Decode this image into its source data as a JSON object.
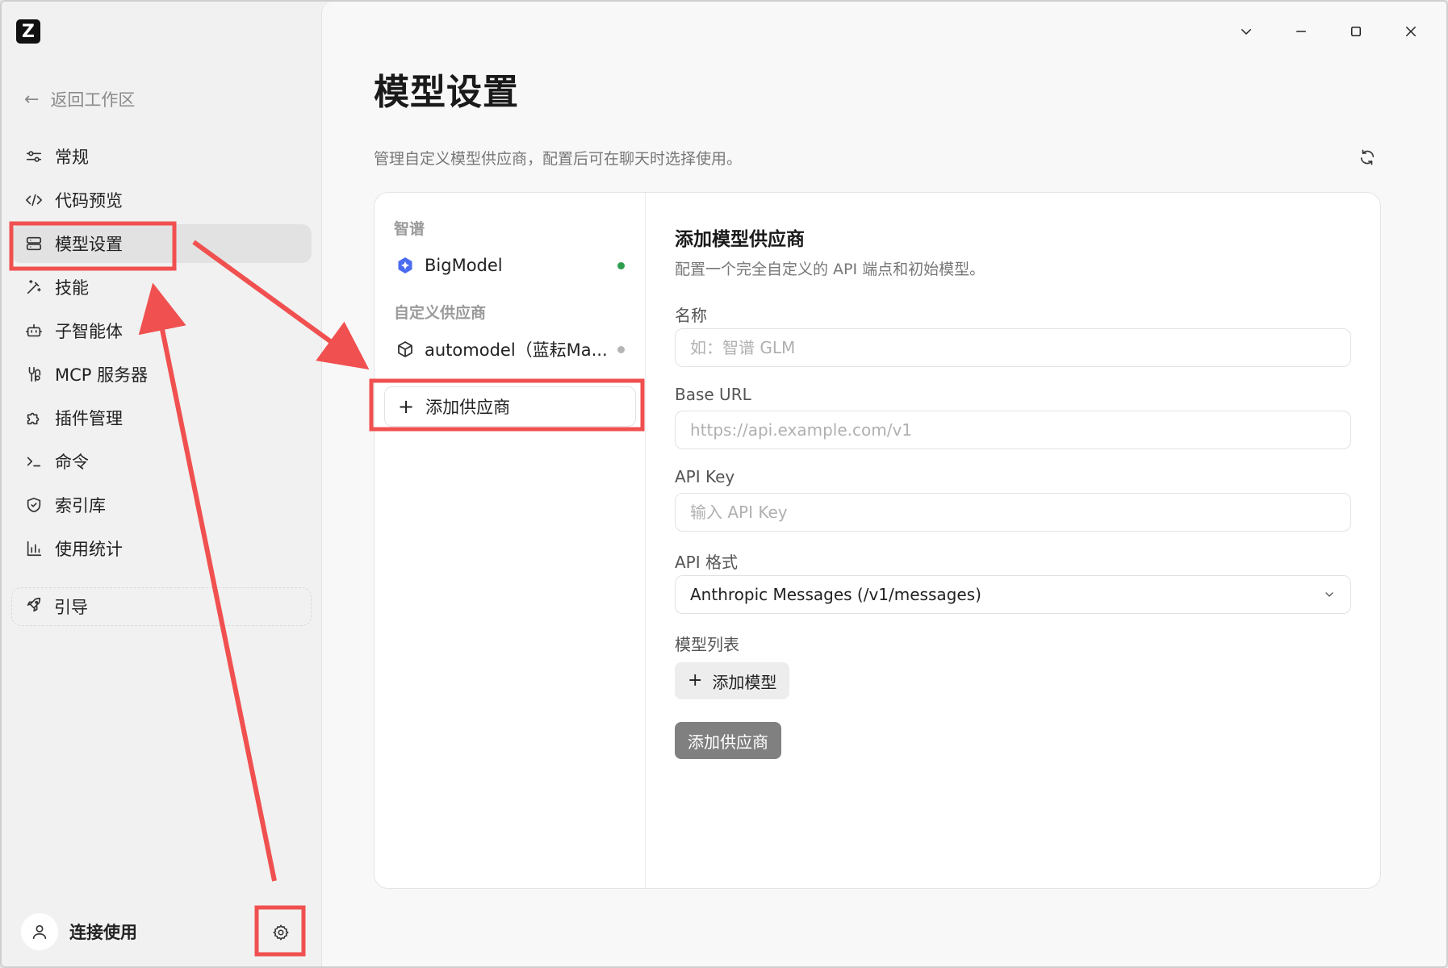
{
  "app": {
    "logo_letter": "Z"
  },
  "sidebar": {
    "back_label": "返回工作区",
    "items": [
      {
        "label": "常规",
        "icon": "sliders-icon",
        "active": false
      },
      {
        "label": "代码预览",
        "icon": "code-icon",
        "active": false
      },
      {
        "label": "模型设置",
        "icon": "server-icon",
        "active": true
      },
      {
        "label": "技能",
        "icon": "magic-wand-icon",
        "active": false
      },
      {
        "label": "子智能体",
        "icon": "robot-icon",
        "active": false
      },
      {
        "label": "MCP 服务器",
        "icon": "plug-icon",
        "active": false
      },
      {
        "label": "插件管理",
        "icon": "puzzle-icon",
        "active": false
      },
      {
        "label": "命令",
        "icon": "terminal-icon",
        "active": false
      },
      {
        "label": "索引库",
        "icon": "shield-icon",
        "active": false
      },
      {
        "label": "使用统计",
        "icon": "bar-chart-icon",
        "active": false
      }
    ],
    "guide_label": "引导",
    "user_name": "连接使用"
  },
  "main": {
    "title": "模型设置",
    "description": "管理自定义模型供应商，配置后可在聊天时选择使用。",
    "providers": {
      "group1_label": "智谱",
      "group1_items": [
        {
          "name": "BigModel",
          "status_color": "#2e9e4f"
        }
      ],
      "group2_label": "自定义供应商",
      "group2_items": [
        {
          "name": "automodel（蓝耘Ma...",
          "status_color": "#b5b5b5"
        }
      ],
      "add_label": "添加供应商"
    },
    "form": {
      "title": "添加模型供应商",
      "subtitle": "配置一个完全自定义的 API 端点和初始模型。",
      "name_label": "名称",
      "name_placeholder": "如：智谱 GLM",
      "base_url_label": "Base URL",
      "base_url_placeholder": "https://api.example.com/v1",
      "api_key_label": "API Key",
      "api_key_placeholder": "输入 API Key",
      "api_format_label": "API 格式",
      "api_format_value": "Anthropic Messages (/v1/messages)",
      "model_list_label": "模型列表",
      "add_model_label": "添加模型",
      "submit_label": "添加供应商"
    }
  },
  "colors": {
    "annotation": "#f0504f",
    "accent_blue": "#4b6cf0"
  }
}
